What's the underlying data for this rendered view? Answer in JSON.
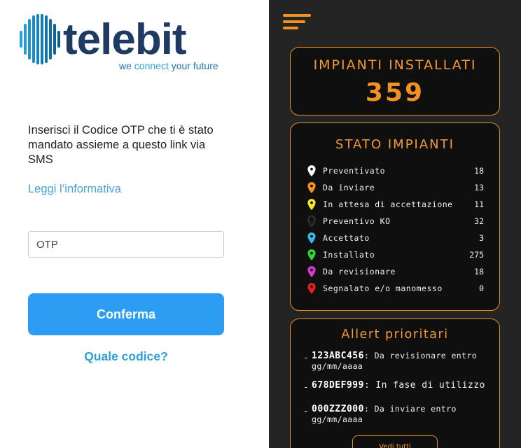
{
  "brand": {
    "wordmark": "telebit",
    "tagline_before": "we ",
    "tagline_emphasis": "connect",
    "tagline_after": " your future"
  },
  "login": {
    "instructions": "Inserisci il Codice OTP che ti è stato mandato assieme a questo link via SMS",
    "privacy_link": "Leggi l’informativa",
    "otp_placeholder": "OTP",
    "confirm_label": "Conferma",
    "which_code_link": "Quale codice?"
  },
  "dashboard": {
    "installed_card": {
      "title": "IMPIANTI INSTALLATI",
      "value": "359"
    },
    "status_card": {
      "title": "STATO IMPIANTI",
      "items": [
        {
          "label": "Preventivato",
          "count": "18",
          "color": "#ffffff"
        },
        {
          "label": "Da inviare",
          "count": "13",
          "color": "#f39223"
        },
        {
          "label": "In attesa di accettazione",
          "count": "11",
          "color": "#f5e92a"
        },
        {
          "label": "Preventivo KO",
          "count": "32",
          "color": "#1a1a1a"
        },
        {
          "label": "Accettato",
          "count": "3",
          "color": "#38b7e6"
        },
        {
          "label": "Installato",
          "count": "275",
          "color": "#35d237"
        },
        {
          "label": "Da revisionare",
          "count": "18",
          "color": "#d53ad0"
        },
        {
          "label": "Segnalato e/o manomesso",
          "count": "0",
          "color": "#e51f1f"
        }
      ]
    },
    "alerts_card": {
      "title": "Allert prioritari",
      "alerts": [
        {
          "code": "123ABC456",
          "text": ": Da revisionare entro gg/mm/aaaa"
        },
        {
          "code": "678DEF999",
          "text": ": In fase di utilizzo"
        },
        {
          "code": "000ZZZ000",
          "text": ": Da inviare entro gg/mm/aaaa"
        }
      ],
      "see_all_label": "Vedi tutti"
    },
    "accent_color": "#f39223",
    "icons": [
      "menu-icon",
      "map-pin-icon"
    ]
  }
}
